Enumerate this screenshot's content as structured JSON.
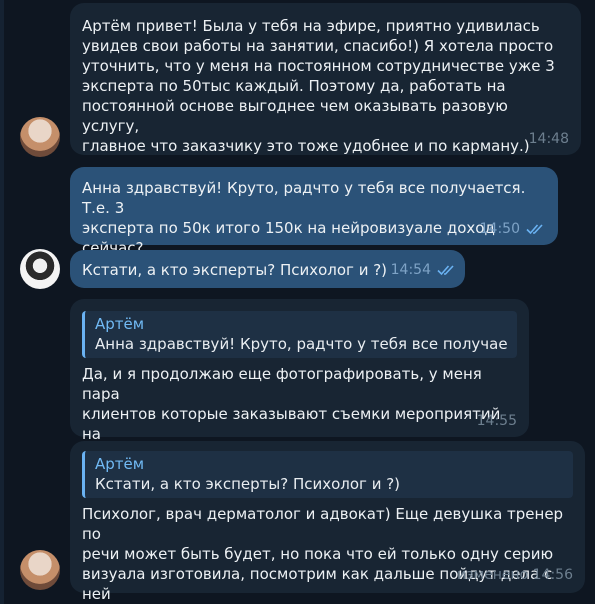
{
  "messages": [
    {
      "text": "Артём привет! Была у тебя на эфире, приятно удивилась\nувидев свои работы на занятии, спасибо!) Я хотела просто\nуточнить, что у меня на постоянном сотрудничестве уже 3\nэксперта по 50тыс каждый. Поэтому да, работать на\nпостоянной основе выгоднее чем оказывать разовую услугу,\nглавное что заказчику это тоже удобнее и по карману.)",
      "time": "14:48"
    },
    {
      "text": "Анна здравствуй! Круто, радчто у тебя все получается. Т.е. 3\nэксперта по 50к итого 150к на нейровизуале доход сейчас?",
      "time": "14:50"
    },
    {
      "text": "Кстати, а кто эксперты? Психолог и ?)",
      "time": "14:54"
    },
    {
      "reply_author": "Артём",
      "reply_text": "Анна здравствуй! Круто, радчто у тебя все получае...",
      "text": "Да, и я продолжаю еще фотографировать, у меня пара\nклиентов которые заказывают съемки мероприятий на\nпостоянной основе",
      "time": "14:55"
    },
    {
      "reply_author": "Артём",
      "reply_text": "Кстати, а кто эксперты? Психолог и ?)",
      "text": "Психолог, врач дерматолог и адвокат) Еще девушка тренер по\nречи может быть будет, но пока что ей только одну серию\nвизуала изготовила, посмотрим как дальше пойдут дела с ней",
      "time": "изменено 14:56"
    }
  ],
  "colors": {
    "background": "#0e1621",
    "incoming": "#182533",
    "outgoing": "#2b5278",
    "accent": "#6ab2f2"
  }
}
